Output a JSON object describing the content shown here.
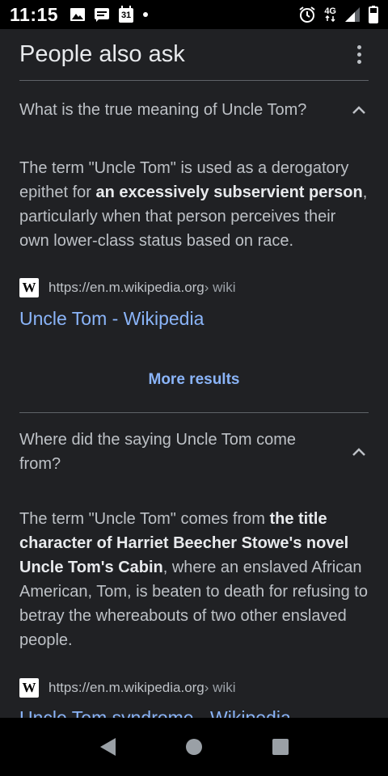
{
  "status_bar": {
    "time": "11:15",
    "calendar_day": "31",
    "network_type": "4G",
    "icons": [
      "image-icon",
      "message-icon",
      "calendar-icon",
      "dot-icon",
      "alarm-icon",
      "network-icon",
      "signal-icon",
      "battery-icon"
    ]
  },
  "paa": {
    "title": "People also ask",
    "questions": [
      {
        "question": "What is the true meaning of Uncle Tom?",
        "answer_parts": [
          "The term \"Uncle Tom\" is used as a derogatory epithet for ",
          "an excessively subservient person",
          ", particularly when that person perceives their own lower-class status based on race."
        ],
        "source_url": "https://en.m.wikipedia.org",
        "source_path": " › wiki",
        "favicon": "W",
        "link_title": "Uncle Tom - Wikipedia"
      },
      {
        "question": "Where did the saying Uncle Tom come from?",
        "answer_parts": [
          "The term \"Uncle Tom\" comes from ",
          "the title character of Harriet Beecher Stowe's novel Uncle Tom's Cabin",
          ", where an enslaved African American, Tom, is beaten to death for refusing to betray the whereabouts of two other enslaved people."
        ],
        "source_url": "https://en.m.wikipedia.org",
        "source_path": " › wiki",
        "favicon": "W",
        "link_title": "Uncle Tom syndrome - Wikipedia"
      }
    ],
    "more_results": "More results"
  },
  "colors": {
    "background": "#202124",
    "text": "#bdc1c6",
    "link": "#8ab4f8",
    "divider": "#5f6368"
  }
}
